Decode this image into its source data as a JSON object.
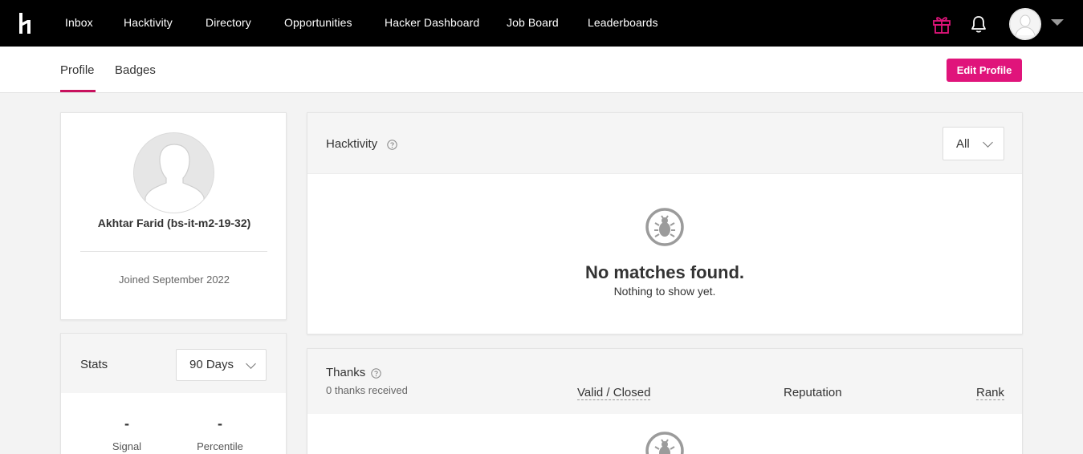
{
  "topnav": {
    "items": [
      "Inbox",
      "Hacktivity",
      "Directory",
      "Opportunities",
      "Hacker Dashboard",
      "Job Board",
      "Leaderboards"
    ],
    "icons": [
      "hackerone-logo-icon",
      "gift-icon",
      "bell-icon",
      "user-avatar",
      "caret-down-icon"
    ]
  },
  "subnav": {
    "tabs": [
      "Profile",
      "Badges"
    ],
    "active_tab": "Profile",
    "edit_button": "Edit Profile"
  },
  "profile": {
    "name": "Akhtar Farid (bs-it-m2-19-32)",
    "joined": "Joined September 2022"
  },
  "stats": {
    "title": "Stats",
    "period": "90 Days",
    "signal_value": "-",
    "signal_label": "Signal",
    "percentile_value": "-",
    "percentile_label": "Percentile"
  },
  "hacktivity": {
    "title": "Hacktivity",
    "filter": "All",
    "empty_title": "No matches found.",
    "empty_sub": "Nothing to show yet."
  },
  "thanks": {
    "title": "Thanks",
    "subtitle": "0 thanks received",
    "col_valid": "Valid / Closed",
    "col_reputation": "Reputation",
    "col_rank": "Rank"
  },
  "colors": {
    "brand": "#e0147b",
    "topbar": "#000000",
    "tab_underline": "#c8115e"
  }
}
